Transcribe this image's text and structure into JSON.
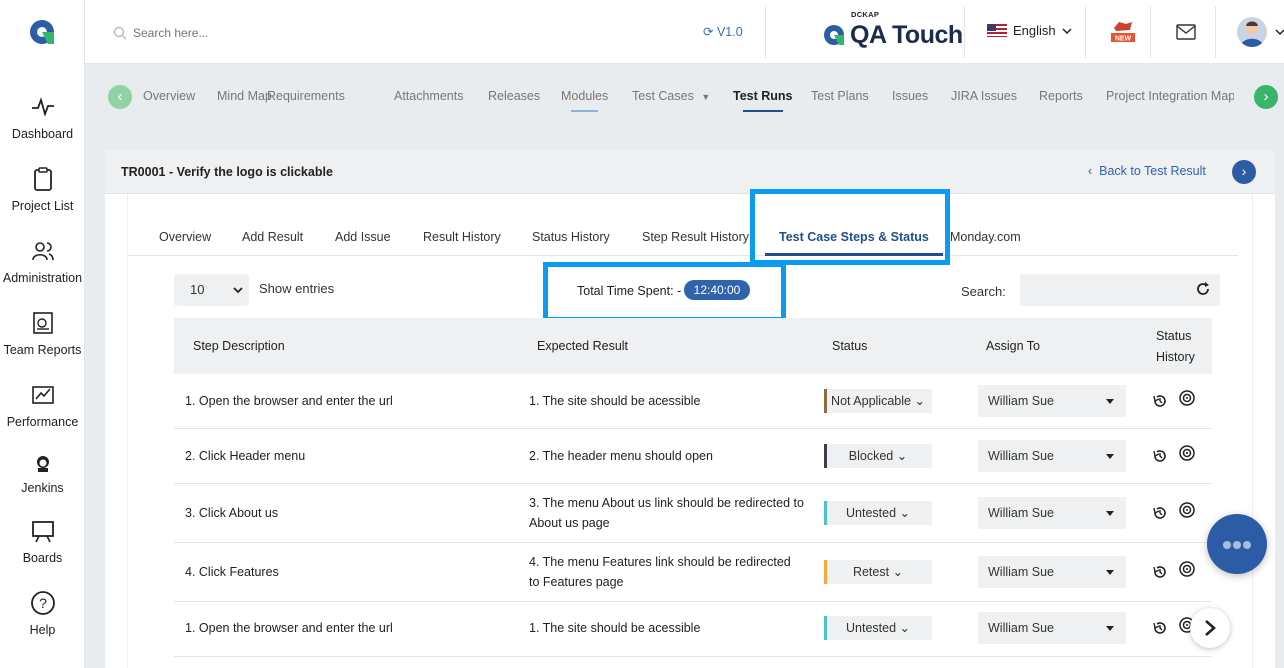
{
  "sidebar": {
    "items": [
      {
        "label": "Dashboard",
        "icon": "pulse-icon"
      },
      {
        "label": "Project List",
        "icon": "clipboard-icon"
      },
      {
        "label": "Administration",
        "icon": "users-icon"
      },
      {
        "label": "Team Reports",
        "icon": "report-icon"
      },
      {
        "label": "Performance",
        "icon": "chart-icon"
      },
      {
        "label": "Jenkins",
        "icon": "jenkins-icon"
      },
      {
        "label": "Boards",
        "icon": "board-icon"
      },
      {
        "label": "Help",
        "icon": "help-icon"
      }
    ]
  },
  "header": {
    "search_placeholder": "Search here...",
    "version": "V1.0",
    "brand_small": "DCKAP",
    "brand_name": "QA Touch",
    "language": "English",
    "new_badge": "NEW"
  },
  "nav": {
    "items": [
      "Overview",
      "Mind Map",
      "Requirements",
      "Attachments",
      "Releases",
      "Modules",
      "Test Cases",
      "Test Runs",
      "Test Plans",
      "Issues",
      "JIRA Issues",
      "Reports",
      "Project Integration Mapp"
    ],
    "active": "Test Runs"
  },
  "card": {
    "title": "TR0001 - Verify the logo is clickable",
    "back_label": "Back to Test Result"
  },
  "subtabs": [
    "Overview",
    "Add Result",
    "Add Issue",
    "Result History",
    "Status History",
    "Step Result History",
    "Test Case Steps & Status",
    "Monday.com"
  ],
  "controls": {
    "entries_value": "10",
    "entries_label": "Show entries",
    "time_label": "Total Time Spent: -",
    "time_value": "12:40:00",
    "search_label": "Search:"
  },
  "table": {
    "headers": [
      "Step Description",
      "Expected Result",
      "Status",
      "Assign To",
      "Status",
      "History"
    ],
    "rows": [
      {
        "step": "1. Open the browser and enter the url",
        "expected": "1. The site should be acessible",
        "status": "Not Applicable",
        "status_color": "#8a6d3b",
        "assign": "William Sue"
      },
      {
        "step": "2. Click Header menu",
        "expected": "2. The header menu should open",
        "status": "Blocked",
        "status_color": "#3a3f4a",
        "assign": "William Sue"
      },
      {
        "step": "3. Click About us",
        "expected": "3. The menu About us link should be redirected to About us page",
        "status": "Untested",
        "status_color": "#4fc3c7",
        "assign": "William Sue"
      },
      {
        "step": "4. Click Features",
        "expected": "4. The menu Features link should be redirected to Features page",
        "status": "Retest",
        "status_color": "#f5a93b",
        "assign": "William Sue"
      },
      {
        "step": "1. Open the browser and enter the url",
        "expected": "1. The site should be acessible",
        "status": "Untested",
        "status_color": "#4fc3c7",
        "assign": "William Sue"
      }
    ]
  }
}
